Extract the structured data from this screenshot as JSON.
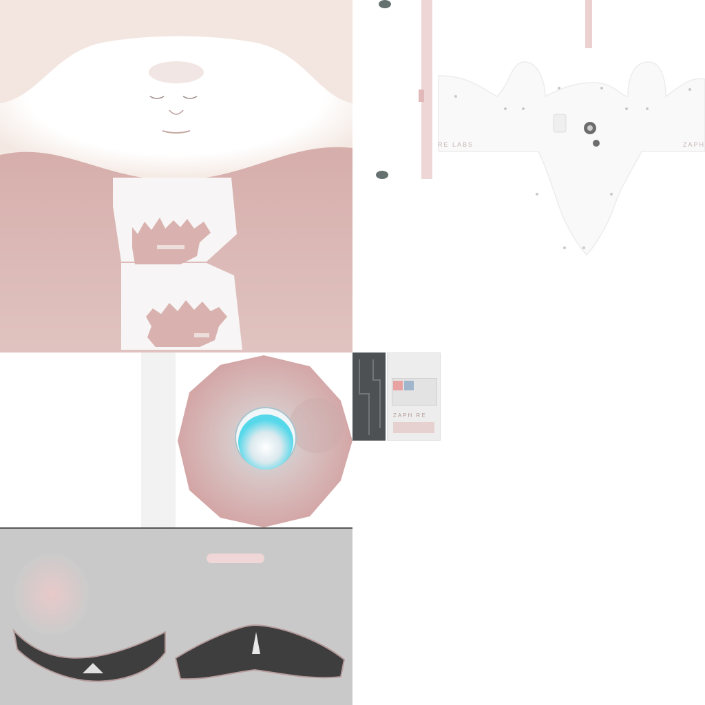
{
  "canvas": {
    "background": "#ffffff"
  },
  "colors": {
    "skin": "#dfbcb9",
    "skin_dark": "#c99e9b",
    "face_bg": "#f4e8e2",
    "white_patch": "#f6f4f4",
    "gray_panel": "#c8c8c8",
    "brow_dark": "#4a4a4a",
    "iris_cyan": "#56d8ea",
    "dark_strip": "#4e5154",
    "outline_gray": "#b7b7b7"
  },
  "texture_text": {
    "left_label": "RE LABS",
    "right_label": "ZAPH",
    "card_label": "ZAPH RE"
  },
  "icons": [
    "rivet-icon",
    "screw-icon",
    "eye-iris-icon",
    "tattoo-flame-icon",
    "eyebrow-shape-icon"
  ]
}
